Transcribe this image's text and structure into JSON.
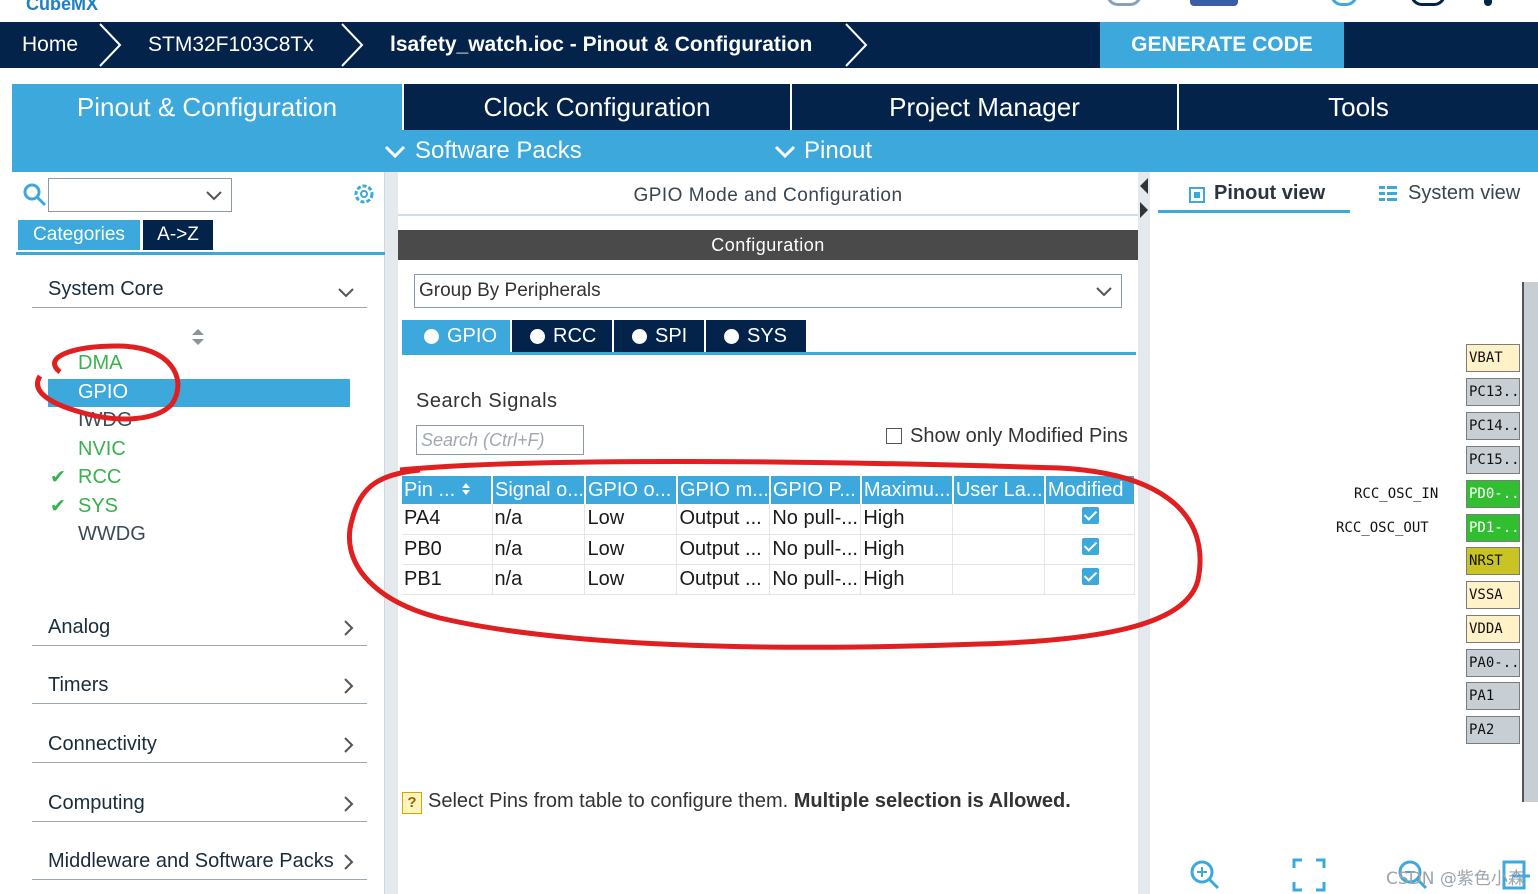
{
  "app": {
    "logo": "CubeMX"
  },
  "breadcrumb": {
    "home": "Home",
    "device": "STM32F103C8Tx",
    "project": "lsafety_watch.ioc - Pinout & Configuration"
  },
  "generate_button": "GENERATE CODE",
  "main_tabs": [
    {
      "label": "Pinout & Configuration",
      "active": true
    },
    {
      "label": "Clock Configuration"
    },
    {
      "label": "Project Manager"
    },
    {
      "label": "Tools"
    }
  ],
  "subbar": {
    "software_packs": "Software Packs",
    "pinout": "Pinout"
  },
  "left": {
    "search_value": "",
    "categories_label": "Categories",
    "az_label": "A->Z",
    "system_core": "System Core",
    "peripherals": [
      {
        "label": "DMA",
        "status": "green"
      },
      {
        "label": "GPIO",
        "status": "selected"
      },
      {
        "label": "IWDG",
        "status": "gray"
      },
      {
        "label": "NVIC",
        "status": "green"
      },
      {
        "label": "RCC",
        "status": "checked"
      },
      {
        "label": "SYS",
        "status": "checked"
      },
      {
        "label": "WWDG",
        "status": "gray"
      }
    ],
    "sections": [
      "Analog",
      "Timers",
      "Connectivity",
      "Computing",
      "Middleware and Software Packs"
    ]
  },
  "center": {
    "mode_header": "GPIO Mode and Configuration",
    "config_header": "Configuration",
    "group_by": "Group By Peripherals",
    "peripheral_tabs": [
      "GPIO",
      "RCC",
      "SPI",
      "SYS"
    ],
    "search_signals_label": "Search Signals",
    "search_placeholder": "Search (Ctrl+F)",
    "show_modified_label": "Show only Modified Pins",
    "table": {
      "headers": [
        "Pin ...",
        "Signal o...",
        "GPIO o...",
        "GPIO m...",
        "GPIO P...",
        "Maximu...",
        "User La...",
        "Modified"
      ],
      "rows": [
        [
          "PA4",
          "n/a",
          "Low",
          "Output ...",
          "No pull-...",
          "High",
          "",
          true
        ],
        [
          "PB0",
          "n/a",
          "Low",
          "Output ...",
          "No pull-...",
          "High",
          "",
          true
        ],
        [
          "PB1",
          "n/a",
          "Low",
          "Output ...",
          "No pull-...",
          "High",
          "",
          true
        ]
      ]
    },
    "hint_normal": "Select Pins from table to configure them.",
    "hint_bold": "Multiple selection is Allowed."
  },
  "right": {
    "pinout_view": "Pinout view",
    "system_view": "System view",
    "pins": [
      "VBAT",
      "PC13..",
      "PC14..",
      "PC15..",
      "PD0-..",
      "PD1-..",
      "NRST",
      "VSSA",
      "VDDA",
      "PA0-..",
      "PA1",
      "PA2"
    ],
    "labels": {
      "osc_in": "RCC_OSC_IN",
      "osc_out": "RCC_OSC_OUT"
    }
  },
  "watermark": "CSDN @紫色小森",
  "colors": {
    "navy": "#03234b",
    "accent": "#3ca8dc",
    "annotation": "#e02020"
  }
}
